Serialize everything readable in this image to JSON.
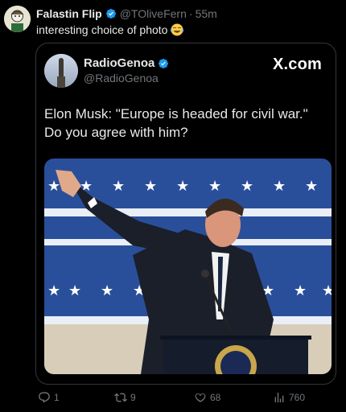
{
  "tweet": {
    "author_name": "Falastin Flip",
    "author_handle": "@TOliveFern",
    "separator": "·",
    "timestamp": "55m",
    "text": "interesting choice of photo",
    "emoji_icon": "laughing-crying-emoji"
  },
  "quoted": {
    "author_name": "RadioGenoa",
    "author_handle": "@RadioGenoa",
    "source_label": "X.com",
    "text": "Elon Musk: \"Europe is headed for civil war.\" Do you agree with him?"
  },
  "actions": {
    "replies": "1",
    "reposts": "9",
    "likes": "68",
    "views": "760"
  },
  "colors": {
    "background": "#000000",
    "text": "#e7e9ea",
    "muted": "#71767b",
    "verified": "#1d9bf0",
    "border": "#333639"
  }
}
